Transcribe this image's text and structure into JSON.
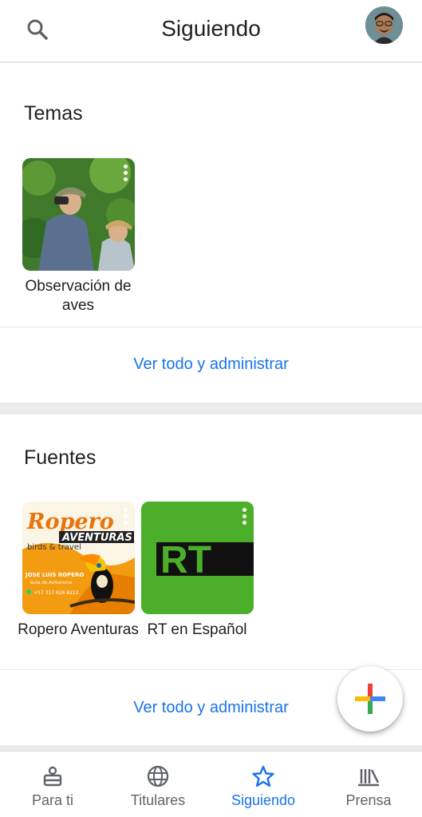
{
  "header": {
    "title": "Siguiendo",
    "search_icon": "search-icon",
    "avatar": "user-avatar"
  },
  "temas": {
    "title": "Temas",
    "items": [
      {
        "label": "Observación de aves",
        "image": "birdwatchers-photo"
      }
    ],
    "manage_link": "Ver todo y administrar"
  },
  "fuentes": {
    "title": "Fuentes",
    "items": [
      {
        "label": "Ropero Aventuras",
        "logo_text": "Ropero",
        "logo_subtext": "AVENTURAS",
        "logo_tagline": "birds & travel",
        "logo_person": "JOSE LUIS ROPERO",
        "logo_role": "Guia de Aviturismo",
        "logo_phone": "+57 317 626 8212"
      },
      {
        "label": "RT en Español",
        "logo_text": "RT"
      }
    ],
    "manage_link": "Ver todo y administrar"
  },
  "fab": {
    "icon": "plus-icon"
  },
  "bottom_nav": {
    "items": [
      {
        "label": "Para ti",
        "icon": "person-icon"
      },
      {
        "label": "Titulares",
        "icon": "globe-icon"
      },
      {
        "label": "Siguiendo",
        "icon": "star-icon"
      },
      {
        "label": "Prensa",
        "icon": "newsstand-icon"
      }
    ],
    "active": "Siguiendo"
  },
  "colors": {
    "accent": "#1a73e8",
    "rt_green": "#4caf2a",
    "ropero_orange": "#f39c12"
  }
}
